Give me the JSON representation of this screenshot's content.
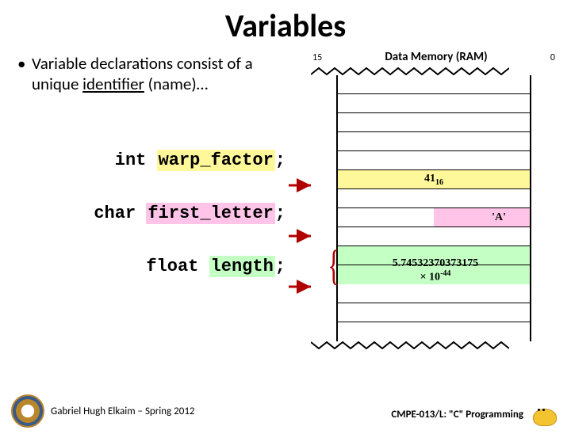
{
  "title": "Variables",
  "bullet": {
    "pre": "Variable declarations consist of a unique ",
    "underlined": "identifier",
    "post": " (name)…"
  },
  "code": {
    "line1_kw": "int ",
    "line1_id": "warp_factor",
    "line2_kw": "char ",
    "line2_id": "first_letter",
    "line3_kw": "float ",
    "line3_id": "length",
    "semi": ";"
  },
  "ram": {
    "header": "Data Memory (RAM)",
    "left_end": "15",
    "right_end": "0",
    "yellow_val_main": "41",
    "yellow_val_sub": "16",
    "pink_val": "'A'",
    "green_val_line1": "5.74532370373175",
    "green_val_line2_pre": "× 10",
    "green_val_line2_sup": "-44"
  },
  "footer": {
    "left": "Gabriel Hugh Elkaim – Spring 2012",
    "right": "CMPE-013/L: \"C\" Programming"
  }
}
